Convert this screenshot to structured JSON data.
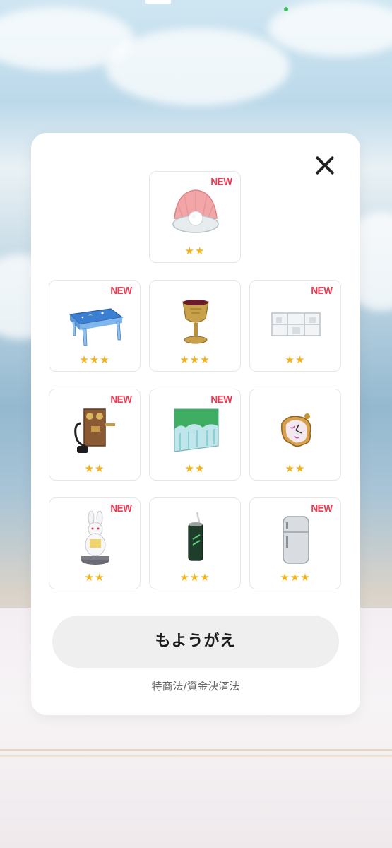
{
  "modal": {
    "close_icon": "close-icon",
    "button_label": "もようがえ",
    "legal_link": "特商法/資金決済法"
  },
  "colors": {
    "new_badge": "#f03a52",
    "star": "#f5b21a",
    "button_bg": "#efefef"
  },
  "items": [
    {
      "name": "shell-pearl",
      "new_label": "NEW",
      "stars": "★★",
      "rarity": 2
    },
    {
      "name": "moon-table",
      "new_label": "NEW",
      "stars": "★★★",
      "rarity": 3
    },
    {
      "name": "golden-goblet",
      "new_label": "",
      "stars": "★★★",
      "rarity": 3
    },
    {
      "name": "wall-shelf",
      "new_label": "NEW",
      "stars": "★★",
      "rarity": 2
    },
    {
      "name": "wall-telephone",
      "new_label": "NEW",
      "stars": "★★",
      "rarity": 2
    },
    {
      "name": "forest-screen",
      "new_label": "NEW",
      "stars": "★★",
      "rarity": 2
    },
    {
      "name": "melting-clock",
      "new_label": "",
      "stars": "★★",
      "rarity": 2
    },
    {
      "name": "white-rabbit-statue",
      "new_label": "NEW",
      "stars": "★★",
      "rarity": 2
    },
    {
      "name": "soda-can",
      "new_label": "",
      "stars": "★★★",
      "rarity": 3
    },
    {
      "name": "retro-fridge",
      "new_label": "NEW",
      "stars": "★★★",
      "rarity": 3
    }
  ]
}
